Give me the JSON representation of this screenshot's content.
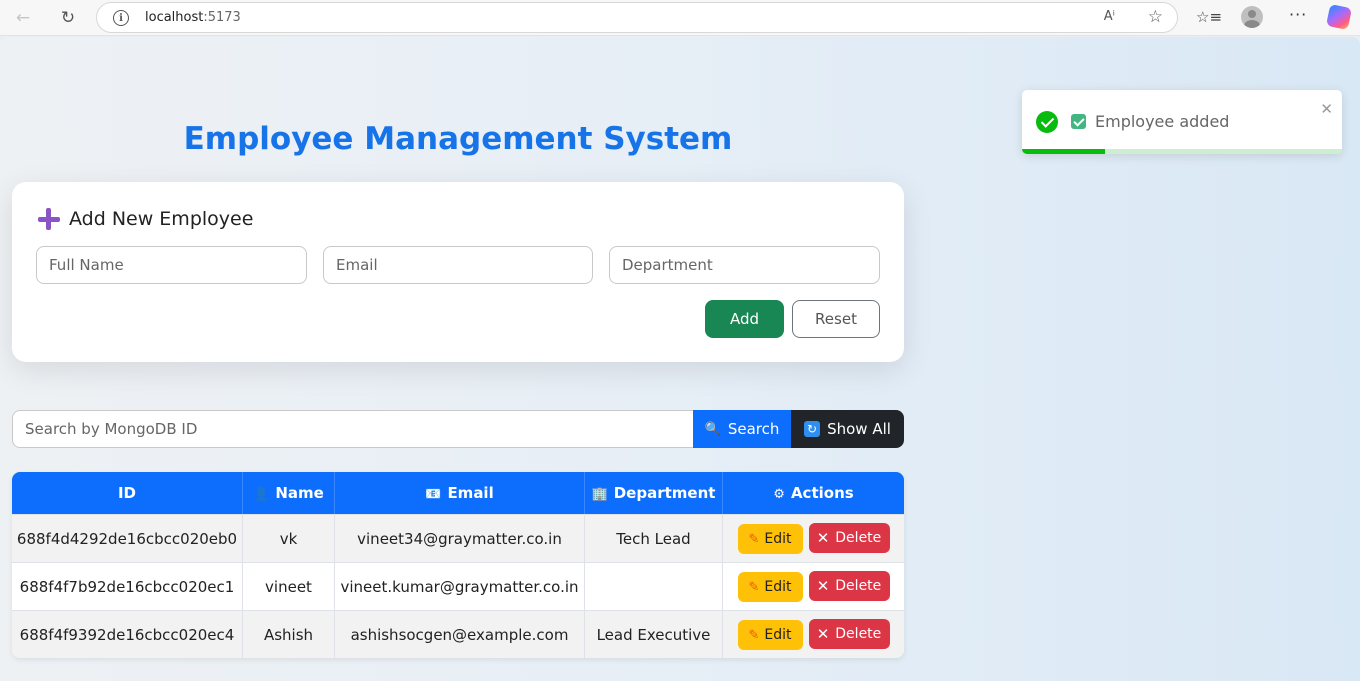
{
  "browser": {
    "url_host": "localhost",
    "url_port": ":5173"
  },
  "page": {
    "title": "Employee Management System"
  },
  "form": {
    "heading": "Add New Employee",
    "name_placeholder": "Full Name",
    "email_placeholder": "Email",
    "department_placeholder": "Department",
    "add_label": "Add",
    "reset_label": "Reset"
  },
  "search": {
    "placeholder": "Search by MongoDB ID",
    "search_label": "Search",
    "show_all_label": "Show All"
  },
  "table": {
    "headers": {
      "id": "ID",
      "name": "Name",
      "email": "Email",
      "department": "Department",
      "actions": "Actions"
    },
    "rows": [
      {
        "id": "688f4d4292de16cbcc020eb0",
        "name": "vk",
        "email": "vineet34@graymatter.co.in",
        "department": "Tech Lead"
      },
      {
        "id": "688f4f7b92de16cbcc020ec1",
        "name": "vineet",
        "email": "vineet.kumar@graymatter.co.in",
        "department": ""
      },
      {
        "id": "688f4f9392de16cbcc020ec4",
        "name": "Ashish",
        "email": "ashishsocgen@example.com",
        "department": "Lead Executive"
      }
    ],
    "edit_label": "Edit",
    "delete_label": "Delete"
  },
  "toast": {
    "message": "Employee added",
    "progress_fraction": 0.26
  },
  "colors": {
    "title": "#1673e8",
    "add": "#198754",
    "search": "#0d6efd",
    "show_all": "#212529",
    "edit": "#ffc107",
    "delete": "#dc3545",
    "toast_success": "#07bc0c"
  }
}
